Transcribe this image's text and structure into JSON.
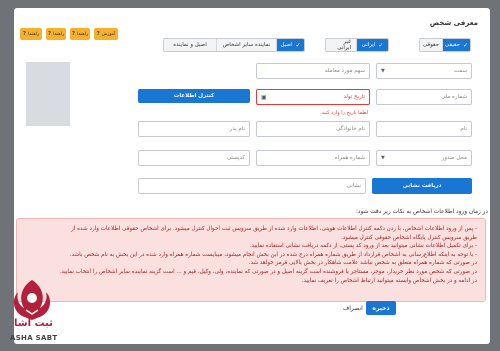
{
  "modal": {
    "title": "معرفی شخص"
  },
  "person_type": {
    "legal": "حقوقی",
    "natural": "حقیقی"
  },
  "nationality": {
    "foreign": "غیر ایرانی",
    "iranian": "ایرانی"
  },
  "role": {
    "principal": "اصیل",
    "other_reps": "نماینده سایر اشخاص",
    "principal_and_rep": "اصیل و نماینده"
  },
  "help_buttons": {
    "tutorial": "آموزش",
    "note1": "راهنما",
    "note2": "راهنما",
    "help": "راهنما"
  },
  "form": {
    "role_select": "سمت",
    "share_placeholder": "سهم مورد معامله",
    "national_id": "شماره ملی",
    "birth_date": "تاریخ تولد",
    "birth_date_error": "لطفا تاریخ را وارد کنید.",
    "check_button": "کنترل اطلاعات",
    "first_name": "نام",
    "last_name": "نام خانوادگی",
    "father_name": "نام پدر",
    "issue_place": "محل صدور",
    "mobile": "شماره همراه",
    "postal_code": "کدپستی",
    "address": "نشانی",
    "get_address_button": "دریافت نشانی"
  },
  "info": {
    "title": "در زمان ورود اطلاعات اشخاص به نکات زیر دقت شود:",
    "lines": [
      "- پس از ورود اطلاعات اشخاص، با زدن دکمه کنترل اطلاعات هویتی، اطلاعات وارد شده از طریق سرویس ثبت احوال کنترل میشود. برای اشخاص حقوقی اطلاعات وارد شده از",
      "طریق سرویس کنترل پایگاه اشخاص حقوقی کنترل میشود.",
      "- برای تکمیل اطلاعات نشانی میتوانید بعد از ورود کد پستی، از دکمه دریافت نشانی استفاده نمایید.",
      "- با توجه به اینکه اطلاع‌رسانی به اشخاص قرارداد از طریق شماره همراه درج شده در این بخش انجام میشود، میبایست شماره همراه وارد شده در این بخش به نام شخص باشد.",
      "در صورتی که شماره همراه متعلق به شخص نباشد علامت شاهکار در بخش بالایی قرمز خواهد شد.",
      "در صورتی که شخص مورد نظر خریدار، موجر، مستاجر یا فروشنده است گزینه اصیل و در صورتی که نماینده، ولی، وکیل، قیم و ... است گزینه نماینده سایر اشخاص را انتخاب نمایید.",
      "در ادامه و در بخش اشخاص وابسته میتوانید ارتباط اشخاص را تعریف نمایید."
    ]
  },
  "footer": {
    "cancel": "انصراف",
    "save": "ذخیره"
  },
  "watermark": {
    "name": "ثبت آشا",
    "subtitle": "ASHA SABT"
  }
}
